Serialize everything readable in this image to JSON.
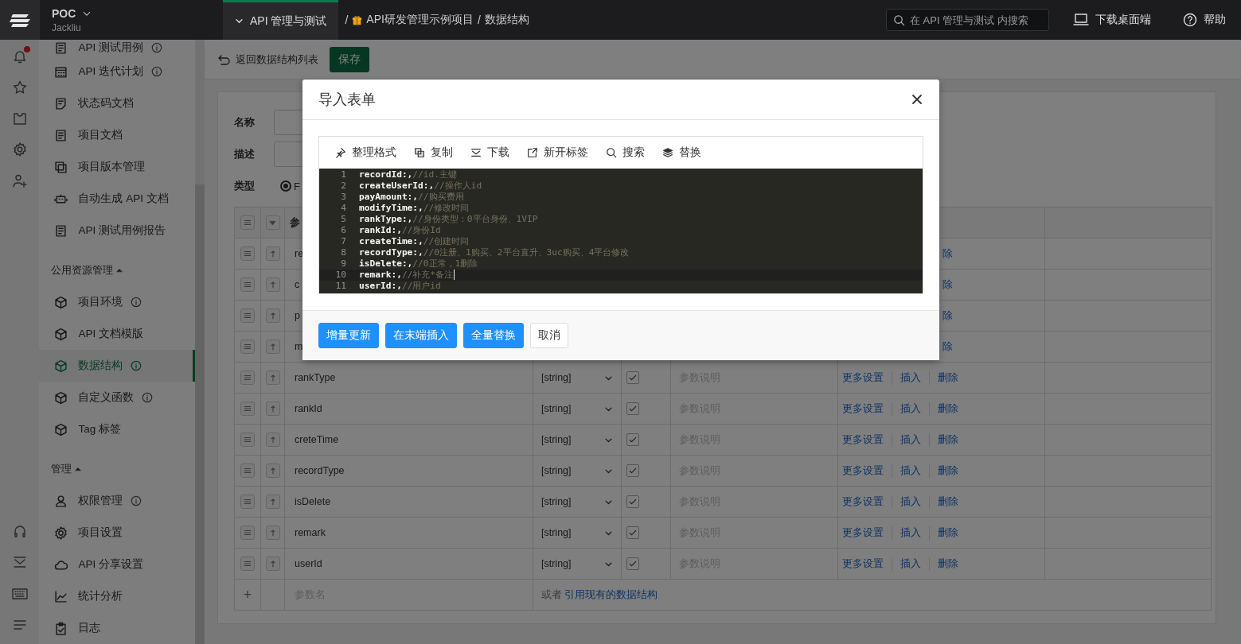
{
  "top_bar": {
    "project": "POC",
    "user": "Jackliu",
    "module_tab": "API 管理与测试",
    "separator": "/",
    "breadcrumb": [
      "API研发管理示例项目",
      "数据结构"
    ],
    "search": {
      "placeholder": "在 API 管理与测试 内搜索"
    },
    "download": "下载桌面端",
    "help": "帮助"
  },
  "rail": {
    "notification_badge": true
  },
  "sidebar": {
    "groups": [
      {
        "items": [
          {
            "label": "API 测试用例",
            "info": true,
            "selected": false
          },
          {
            "label": "API 迭代计划",
            "info": true,
            "selected": false
          },
          {
            "label": "状态码文档",
            "info": false,
            "selected": false
          },
          {
            "label": "项目文档",
            "info": false,
            "selected": false
          },
          {
            "label": "项目版本管理",
            "info": false,
            "selected": false
          },
          {
            "label": "自动生成 API 文档",
            "info": false,
            "selected": false
          },
          {
            "label": "API 测试用例报告",
            "info": false,
            "selected": false
          }
        ]
      },
      {
        "title": "公用资源管理",
        "expanded": true,
        "items": [
          {
            "label": "项目环境",
            "info": true,
            "selected": false
          },
          {
            "label": "API 文档模版",
            "info": false,
            "selected": false
          },
          {
            "label": "数据结构",
            "info": true,
            "selected": true
          },
          {
            "label": "自定义函数",
            "info": true,
            "selected": false
          },
          {
            "label": "Tag 标签",
            "info": false,
            "selected": false
          }
        ]
      },
      {
        "title": "管理",
        "expanded": true,
        "items": [
          {
            "label": "权限管理",
            "info": true,
            "selected": false
          },
          {
            "label": "项目设置",
            "info": false,
            "selected": false
          },
          {
            "label": "API 分享设置",
            "info": false,
            "selected": false
          },
          {
            "label": "统计分析",
            "info": false,
            "selected": false
          },
          {
            "label": "日志",
            "info": false,
            "selected": false
          }
        ]
      }
    ]
  },
  "toolbar": {
    "back": "返回数据结构列表",
    "save": "保存"
  },
  "form": {
    "name_label": "名称",
    "desc_label": "描述",
    "type_label": "类型",
    "type_options": [
      {
        "label": "F",
        "selected": true
      }
    ]
  },
  "table": {
    "header": "参",
    "rows": [
      {
        "kind": "covered",
        "name": "re",
        "delete": "除"
      },
      {
        "kind": "covered",
        "name": "c",
        "delete": "除"
      },
      {
        "kind": "covered",
        "name": "p",
        "delete": "除"
      },
      {
        "kind": "covered",
        "name": "m",
        "delete": "除"
      },
      {
        "kind": "full",
        "name": "rankType",
        "type": "[string]",
        "required": true,
        "description_placeholder": "参数说明",
        "actions": [
          "更多设置",
          "插入",
          "删除"
        ]
      },
      {
        "kind": "full",
        "name": "rankId",
        "type": "[string]",
        "required": true,
        "description_placeholder": "参数说明",
        "actions": [
          "更多设置",
          "插入",
          "删除"
        ]
      },
      {
        "kind": "full",
        "name": "creteTime",
        "type": "[string]",
        "required": true,
        "description_placeholder": "参数说明",
        "actions": [
          "更多设置",
          "插入",
          "删除"
        ]
      },
      {
        "kind": "full",
        "name": "recordType",
        "type": "[string]",
        "required": true,
        "description_placeholder": "参数说明",
        "actions": [
          "更多设置",
          "插入",
          "删除"
        ]
      },
      {
        "kind": "full",
        "name": "isDelete",
        "type": "[string]",
        "required": true,
        "description_placeholder": "参数说明",
        "actions": [
          "更多设置",
          "插入",
          "删除"
        ]
      },
      {
        "kind": "full",
        "name": "remark",
        "type": "[string]",
        "required": true,
        "description_placeholder": "参数说明",
        "actions": [
          "更多设置",
          "插入",
          "删除"
        ]
      },
      {
        "kind": "full",
        "name": "userId",
        "type": "[string]",
        "required": true,
        "description_placeholder": "参数说明",
        "actions": [
          "更多设置",
          "插入",
          "删除"
        ]
      }
    ],
    "add_row": {
      "add_button": "+",
      "placeholder": "参数名",
      "or_text": "或者",
      "link": "引用现有的数据结构"
    }
  },
  "modal": {
    "title": "导入表单",
    "tools": [
      "整理格式",
      "复制",
      "下载",
      "新开标签",
      "搜索",
      "替换"
    ],
    "lines": [
      {
        "number": "1",
        "key": "recordId:,",
        "comment": "//id.主键",
        "active": false
      },
      {
        "number": "2",
        "key": "createUserId:,",
        "comment": "//操作人id",
        "active": false
      },
      {
        "number": "3",
        "key": "payAmount:,",
        "comment": "//购买费用",
        "active": false
      },
      {
        "number": "4",
        "key": "modifyTime:,",
        "comment": "//修改时间",
        "active": false
      },
      {
        "number": "5",
        "key": "rankType:,",
        "comment": "//身份类型：0平台身份、1VIP",
        "active": false
      },
      {
        "number": "6",
        "key": "rankId:,",
        "comment": "//身份Id",
        "active": false
      },
      {
        "number": "7",
        "key": "createTime:,",
        "comment": "//创建时间",
        "active": false
      },
      {
        "number": "8",
        "key": "recordType:,",
        "comment": "//0注册、1购买、2平台直升、3uc购买、4平台修改",
        "active": false
      },
      {
        "number": "9",
        "key": "isDelete:,",
        "comment": "//0正常，1删除",
        "active": false
      },
      {
        "number": "10",
        "key": "remark:,",
        "comment": "//补充*备注",
        "active": true
      },
      {
        "number": "11",
        "key": "userId:,",
        "comment": "//用户id",
        "active": false
      }
    ],
    "buttons": [
      {
        "label": "增量更新",
        "primary": true
      },
      {
        "label": "在末端插入",
        "primary": true
      },
      {
        "label": "全量替换",
        "primary": true
      },
      {
        "label": "取消",
        "primary": false
      }
    ]
  }
}
